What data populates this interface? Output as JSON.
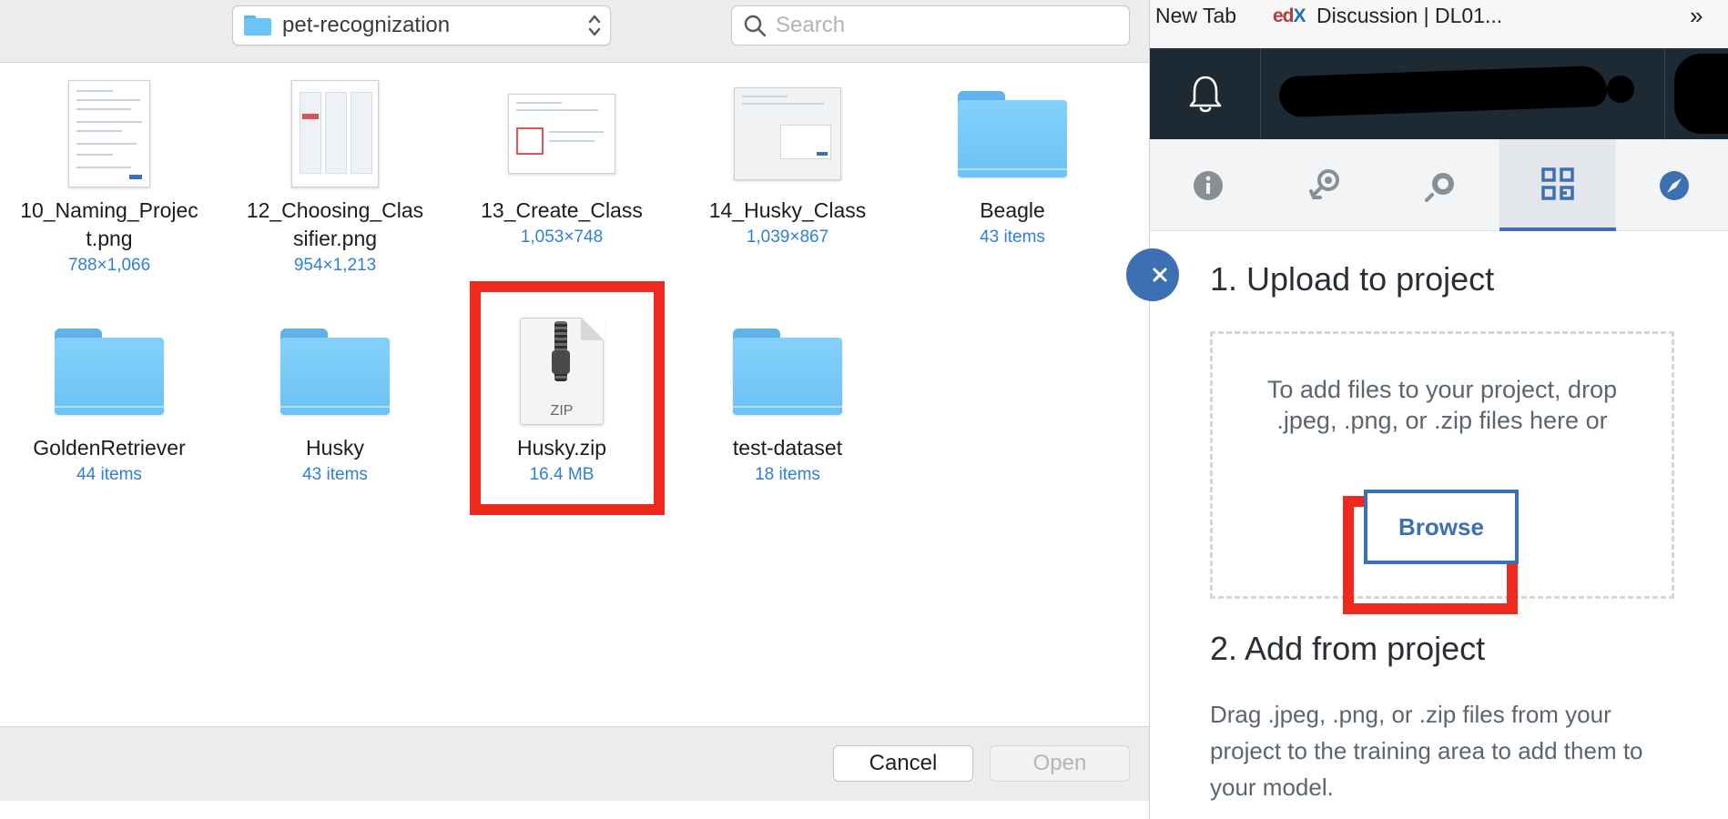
{
  "dialog": {
    "folder_name": "pet-recognization",
    "search_placeholder": "Search",
    "files": [
      {
        "name": "10_Naming_Project.png",
        "name_line1": "10_Naming_Projec",
        "name_line2": "t.png",
        "meta": "788×1,066",
        "kind": "png"
      },
      {
        "name": "12_Choosing_Classifier.png",
        "name_line1": "12_Choosing_Clas",
        "name_line2": "sifier.png",
        "meta": "954×1,213",
        "kind": "png"
      },
      {
        "name": "13_Create_Class",
        "meta": "1,053×748",
        "kind": "png"
      },
      {
        "name": "14_Husky_Class",
        "meta": "1,039×867",
        "kind": "png"
      },
      {
        "name": "Beagle",
        "meta": "43 items",
        "kind": "folder"
      },
      {
        "name": "GoldenRetriever",
        "meta": "44 items",
        "kind": "folder"
      },
      {
        "name": "Husky",
        "meta": "43 items",
        "kind": "folder"
      },
      {
        "name": "Husky.zip",
        "meta": "16.4 MB",
        "kind": "zip",
        "badge": "ZIP",
        "highlighted": true
      },
      {
        "name": "test-dataset",
        "meta": "18 items",
        "kind": "folder"
      }
    ],
    "cancel_label": "Cancel",
    "open_label": "Open",
    "open_enabled": false
  },
  "browser": {
    "bookmarks": {
      "new_tab": "New Tab",
      "edx_logo_e": "ed",
      "edx_logo_x": "X",
      "discussion": "Discussion | DL01...",
      "more": "»"
    },
    "tabs": [
      "info-icon",
      "model-icon",
      "refresh-icon",
      "data-icon",
      "explore-icon"
    ],
    "active_tab": 3,
    "panel": {
      "upload_title": "1. Upload to project",
      "drop_message": "To add files to your project, drop .jpeg, .png, or .zip files here or",
      "browse_label": "Browse",
      "add_title": "2. Add from project",
      "add_description": "Drag .jpeg, .png, or .zip files from your project to the training area to add them to your model."
    }
  },
  "colors": {
    "highlight": "#f0291f",
    "accent": "#3d70b2",
    "topbar": "#1d2a33",
    "meta_text": "#2f7fd6"
  }
}
